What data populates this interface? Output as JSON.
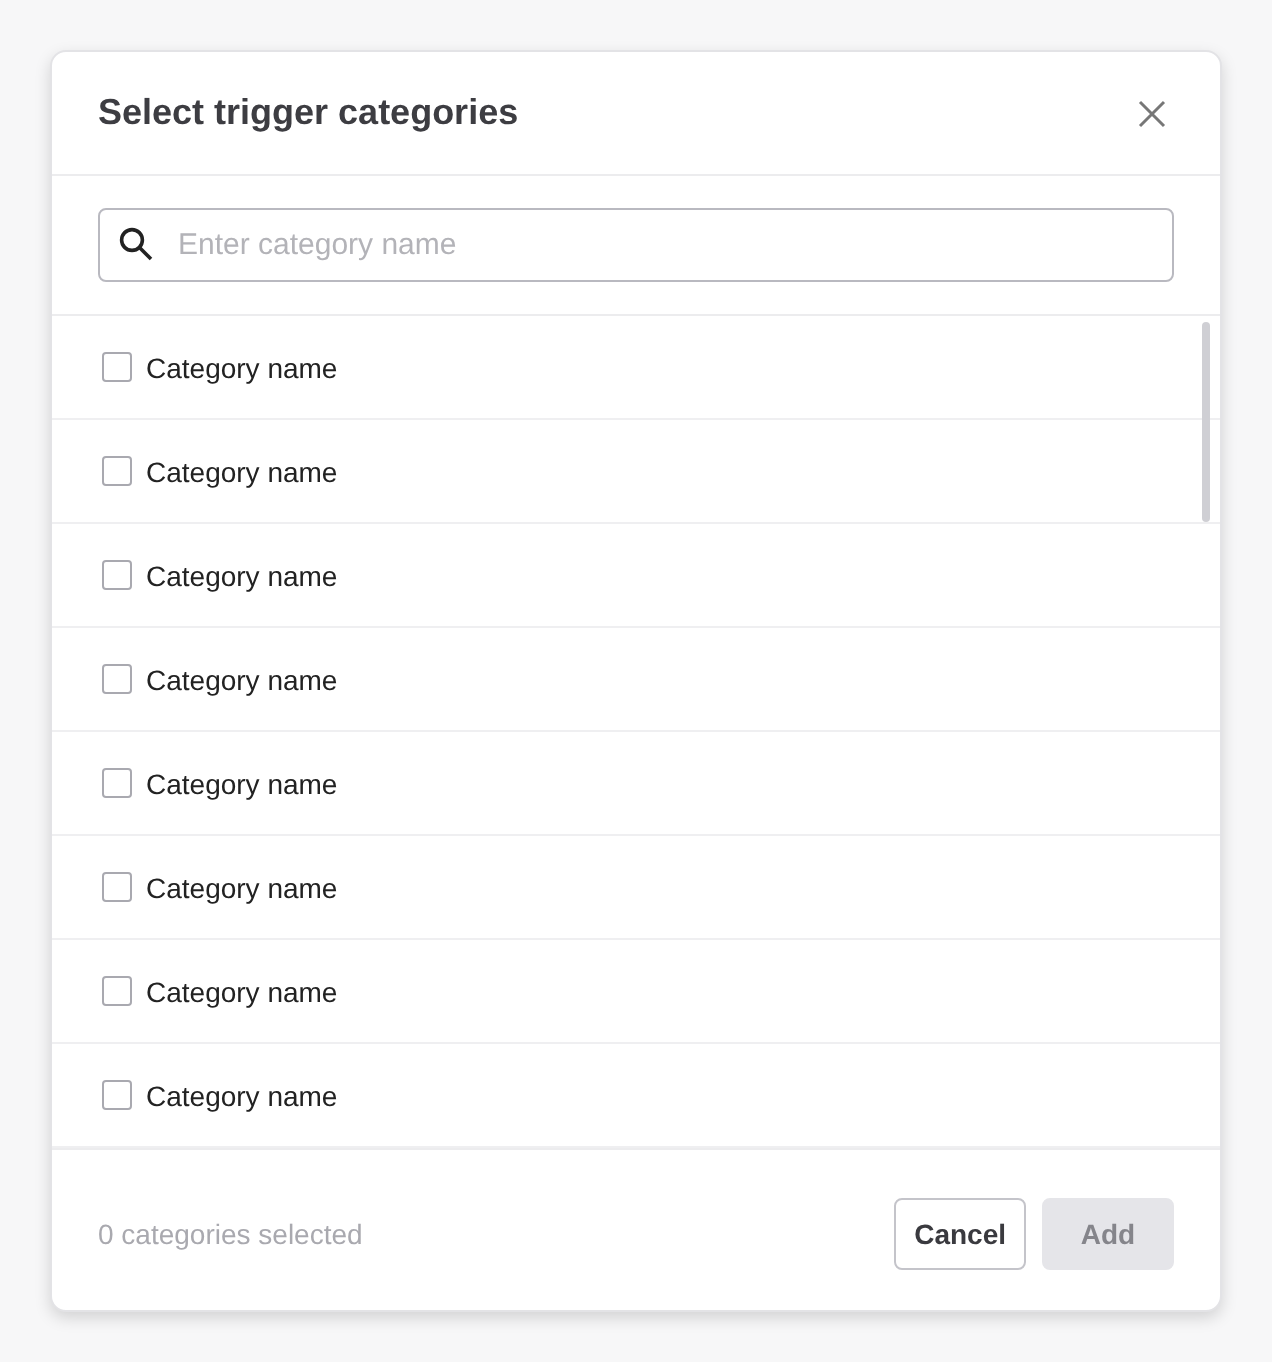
{
  "dialog": {
    "title": "Select trigger categories"
  },
  "search": {
    "placeholder": "Enter category name"
  },
  "categories": [
    {
      "label": "Category name",
      "checked": false
    },
    {
      "label": "Category name",
      "checked": false
    },
    {
      "label": "Category name",
      "checked": false
    },
    {
      "label": "Category name",
      "checked": false
    },
    {
      "label": "Category name",
      "checked": false
    },
    {
      "label": "Category name",
      "checked": false
    },
    {
      "label": "Category name",
      "checked": false
    },
    {
      "label": "Category name",
      "checked": false
    }
  ],
  "footer": {
    "summary": "0 categories selected",
    "buttons": [
      {
        "label": "Cancel",
        "kind": "secondary",
        "disabled": false
      },
      {
        "label": "Add",
        "kind": "primary",
        "disabled": true
      }
    ]
  }
}
